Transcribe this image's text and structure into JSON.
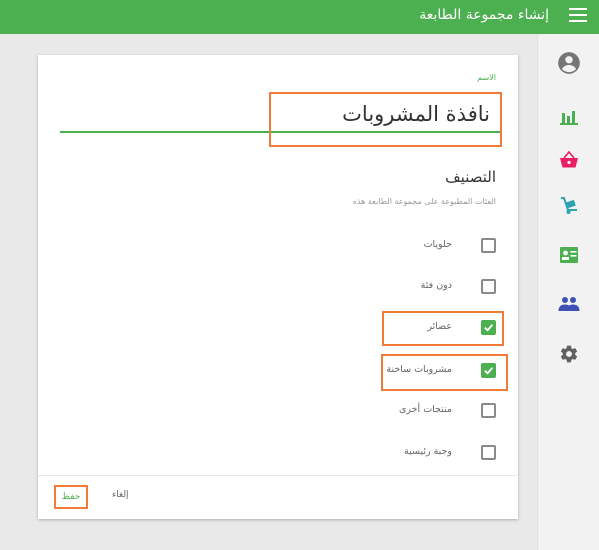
{
  "topbar": {
    "title": "إنشاء مجموعة الطابعة"
  },
  "sidebar": {
    "items": [
      {
        "icon": "account-circle-icon"
      },
      {
        "icon": "bar-chart-icon"
      },
      {
        "icon": "shopping-basket-icon"
      },
      {
        "icon": "hand-truck-icon"
      },
      {
        "icon": "contact-card-icon"
      },
      {
        "icon": "people-icon"
      },
      {
        "icon": "settings-icon"
      }
    ]
  },
  "form": {
    "name_label": "الاسم",
    "name_value": "نافذة المشروبات",
    "section_title": "التصنيف",
    "section_subtitle": "الفئات المطبوعة على مجموعة الطابعة هذه",
    "categories": [
      {
        "label": "حلويات",
        "checked": false
      },
      {
        "label": "دون فئة",
        "checked": false
      },
      {
        "label": "عصائر",
        "checked": true
      },
      {
        "label": "مشروبات ساخنة",
        "checked": true
      },
      {
        "label": "منتجات أخرى",
        "checked": false
      },
      {
        "label": "وجبة رئيسية",
        "checked": false
      }
    ]
  },
  "actions": {
    "save_label": "حفظ",
    "cancel_label": "إلغاء"
  },
  "colors": {
    "primary": "#4caf50",
    "highlight": "#f07c37",
    "basket": "#e91e63",
    "cart": "#2aa3b3",
    "people": "#3f51b5"
  }
}
